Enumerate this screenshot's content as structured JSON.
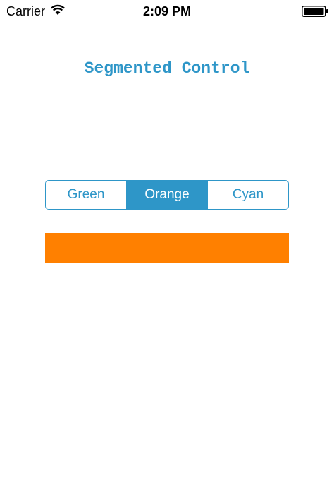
{
  "status_bar": {
    "carrier": "Carrier",
    "time": "2:09 PM",
    "wifi_icon": "wifi-icon",
    "battery_icon": "battery-icon"
  },
  "title": {
    "text": "Segmented Control",
    "color": "#2e96c8"
  },
  "segmented_control": {
    "segments": [
      {
        "label": "Green",
        "selected": false
      },
      {
        "label": "Orange",
        "selected": true
      },
      {
        "label": "Cyan",
        "selected": false
      }
    ],
    "tint_color": "#2e96c8"
  },
  "swatch": {
    "color": "#ff8000"
  }
}
